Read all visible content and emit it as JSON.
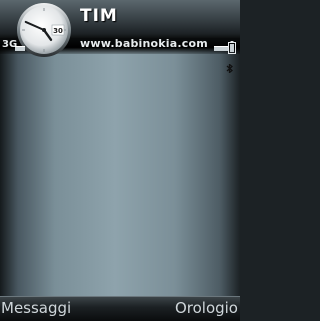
{
  "status": {
    "operator": "TIM",
    "url": "www.babinokia.com",
    "network_type": "3G",
    "clock": {
      "hour": 4,
      "minute": 49,
      "date_label": "30"
    }
  },
  "icons": {
    "signal": "signal-strength-icon",
    "battery": "battery-icon",
    "bluetooth": "bluetooth-icon"
  },
  "softkeys": {
    "left": "Messaggi",
    "right": "Orologio"
  },
  "colors": {
    "background_center": "#8ea3ac",
    "background_edge": "#151a1c",
    "text_light": "#cfd6da"
  }
}
